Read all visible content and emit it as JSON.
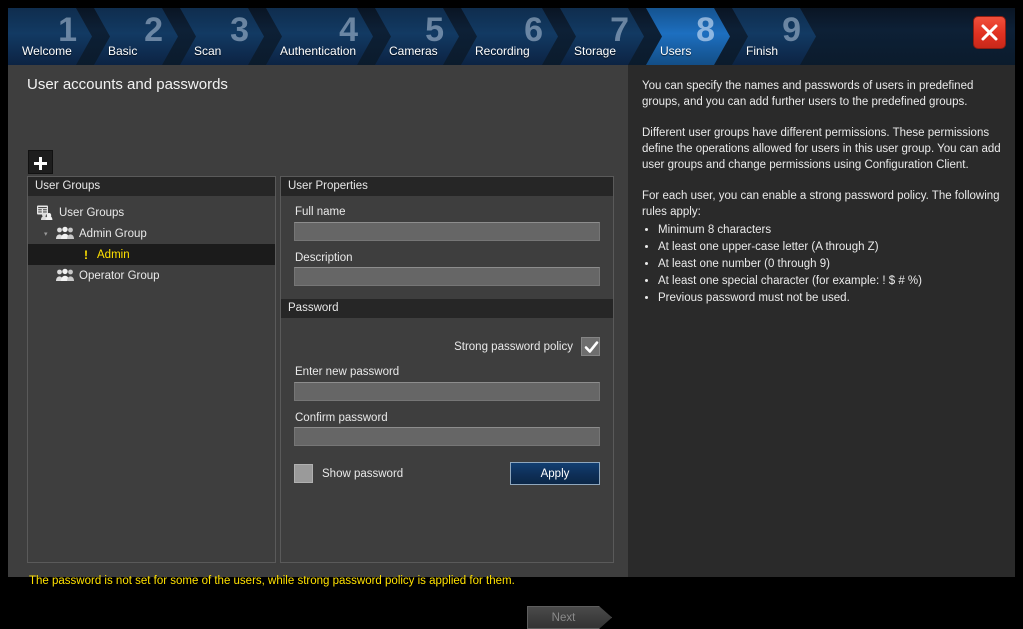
{
  "header": {
    "steps": [
      {
        "num": "1",
        "label": "Welcome",
        "active": false
      },
      {
        "num": "2",
        "label": "Basic",
        "active": false
      },
      {
        "num": "3",
        "label": "Scan",
        "active": false
      },
      {
        "num": "4",
        "label": "Authentication",
        "active": false
      },
      {
        "num": "5",
        "label": "Cameras",
        "active": false
      },
      {
        "num": "6",
        "label": "Recording",
        "active": false
      },
      {
        "num": "7",
        "label": "Storage",
        "active": false
      },
      {
        "num": "8",
        "label": "Users",
        "active": true
      },
      {
        "num": "9",
        "label": "Finish",
        "active": false
      }
    ],
    "close_icon": "close-icon",
    "active_color": "#1d6fc0"
  },
  "page": {
    "title": "User accounts and passwords",
    "add_button_icon": "plus-icon"
  },
  "groups_panel": {
    "header": "User Groups",
    "tree": [
      {
        "label": "User Groups",
        "level": 0,
        "icon": "user-groups-root-icon",
        "selected": false,
        "twisty": ""
      },
      {
        "label": "Admin Group",
        "level": 1,
        "icon": "group-icon",
        "selected": false,
        "twisty": "▾"
      },
      {
        "label": "Admin",
        "level": 2,
        "icon": "warning-icon",
        "selected": true,
        "twisty": ""
      },
      {
        "label": "Operator Group",
        "level": 1,
        "icon": "group-icon",
        "selected": false,
        "twisty": ""
      }
    ]
  },
  "properties_panel": {
    "header": "User Properties",
    "full_name_label": "Full name",
    "full_name_value": "",
    "description_label": "Description",
    "description_value": "",
    "password_section_header": "Password",
    "strong_policy_label": "Strong password policy",
    "strong_policy_checked": true,
    "new_password_label": "Enter new password",
    "new_password_value": "",
    "confirm_password_label": "Confirm password",
    "confirm_password_value": "",
    "show_password_label": "Show password",
    "show_password_checked": false,
    "apply_label": "Apply"
  },
  "status": {
    "warning_message": "The password is not set for some of the users, while strong password policy is applied for them.",
    "warning_color": "#ffe100"
  },
  "footer": {
    "next_label": "Next",
    "next_enabled": false
  },
  "help": {
    "paragraphs": [
      "You can specify the names and passwords of users in predefined groups, and you can add further users to the predefined groups.",
      "Different user groups have different permissions. These permissions define the operations allowed for users in this user group. You can add user groups and change permissions using Configuration Client.",
      "For each user, you can enable a strong password policy. The following rules apply:"
    ],
    "bullets": [
      "Minimum 8 characters",
      "At least one upper-case letter (A through Z)",
      "At least one number (0 through 9)",
      "At least one special character (for example: ! $ # %)",
      "Previous password must not be used."
    ]
  }
}
